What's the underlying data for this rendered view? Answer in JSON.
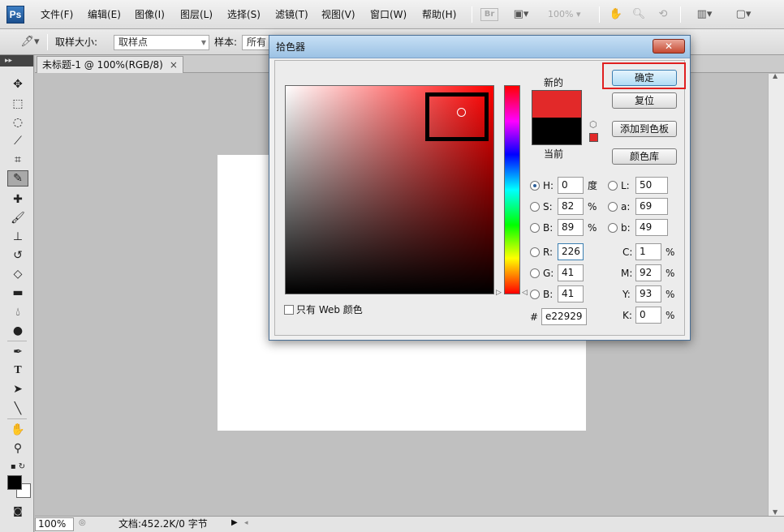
{
  "app": {
    "logo_text": "Ps"
  },
  "menu": [
    "文件(F)",
    "编辑(E)",
    "图像(I)",
    "图层(L)",
    "选择(S)",
    "滤镜(T)",
    "视图(V)",
    "窗口(W)",
    "帮助(H)"
  ],
  "appbar": {
    "bridge_label": "Br",
    "zoom_value": "100%"
  },
  "options_bar": {
    "sample_size_label": "取样大小:",
    "sample_size_value": "取样点",
    "sample_label": "样本:",
    "sample_value": "所有图"
  },
  "document": {
    "tab_title": "未标题-1 @ 100%(RGB/8)",
    "close_glyph": "×",
    "zoom": "100%",
    "info": "文档:452.2K/0 字节"
  },
  "toolbox": {
    "tools": [
      "move",
      "marquee",
      "lasso",
      "quick-select",
      "crop",
      "eyedropper",
      "healing-brush",
      "brush",
      "clone-stamp",
      "history-brush",
      "eraser",
      "gradient",
      "blur",
      "dodge",
      "pen",
      "type",
      "path-select",
      "line",
      "hand",
      "zoom"
    ],
    "active_tool": "eyedropper",
    "foreground_color": "#000000",
    "background_color": "#ffffff"
  },
  "color_picker": {
    "title": "拾色器",
    "close_glyph": "✕",
    "buttons": {
      "ok": "确定",
      "reset": "复位",
      "add_swatch": "添加到色板",
      "libraries": "颜色库"
    },
    "new_label": "新的",
    "current_label": "当前",
    "new_color": "#e22929",
    "current_color": "#000000",
    "web_only_label": "只有 Web 颜色",
    "web_only_checked": false,
    "hsb": {
      "h": "0",
      "s": "82",
      "b": "89",
      "h_unit": "度",
      "s_unit": "%",
      "b_unit": "%"
    },
    "lab": {
      "l": "50",
      "a": "69",
      "b": "49"
    },
    "rgb": {
      "r": "226",
      "g": "41",
      "b": "41"
    },
    "cmyk": {
      "c": "1",
      "m": "92",
      "y": "93",
      "k": "0",
      "unit": "%"
    },
    "hex_label": "#",
    "hex": "e22929",
    "selected_mode": "H",
    "field_labels": {
      "h": "H:",
      "s": "S:",
      "b": "B:",
      "r": "R:",
      "g": "G:",
      "bb": "B:",
      "l": "L:",
      "a": "a:",
      "lab_b": "b:",
      "c": "C:",
      "m": "M:",
      "y": "Y:",
      "k": "K:"
    }
  }
}
